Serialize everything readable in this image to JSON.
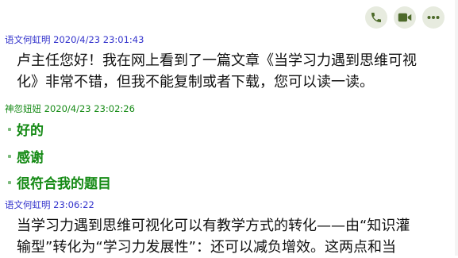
{
  "toolbar": {
    "icons": [
      "phone-icon",
      "video-call-icon",
      "more-options-icon"
    ],
    "icon_color": "#4d6a2a",
    "button_bg": "#e7ebdf"
  },
  "messages": [
    {
      "sender": "语文何虹明",
      "timestamp": "2020/4/23 23:01:43",
      "sender_color": "#3333cc",
      "text_lines": [
        "卢主任您好！我在网上看到了一篇文章《当学习力遇到思维可视",
        "化》非常不错，但我不能复制或者下载，您可以读一读。"
      ]
    },
    {
      "sender": "神忽妞妞",
      "timestamp": "2020/4/23 23:02:26",
      "sender_color": "#158a15",
      "replies": [
        "好的",
        "感谢",
        "很符合我的题目"
      ]
    },
    {
      "sender": "语文何虹明",
      "timestamp": "23:06:22",
      "sender_color": "#3333cc",
      "text_lines": [
        "当学习力遇到思维可视化可以有教学方式的转化——由“知识灌",
        "输型”转化为“学习力发展性”：还可以减负增效。这两点和当"
      ]
    }
  ]
}
